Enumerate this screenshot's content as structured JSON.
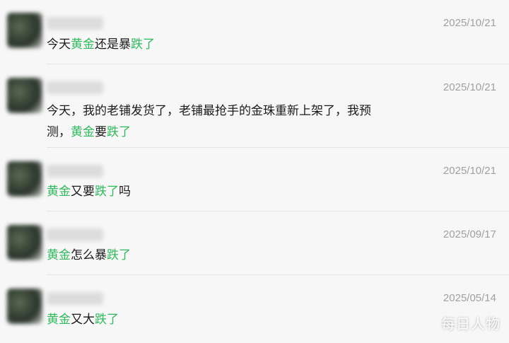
{
  "comments": [
    {
      "date": "2025/10/21",
      "segments": [
        {
          "text": "今天",
          "highlight": false
        },
        {
          "text": "黄金",
          "highlight": true
        },
        {
          "text": "还是暴",
          "highlight": false
        },
        {
          "text": "跌了",
          "highlight": true
        }
      ]
    },
    {
      "date": "2025/10/21",
      "segments": [
        {
          "text": "今天，我的老铺发货了，老铺最抢手的金珠重新上架了，我预",
          "highlight": false
        },
        {
          "text": "\n",
          "highlight": false
        },
        {
          "text": "测，",
          "highlight": false
        },
        {
          "text": "黄金",
          "highlight": true
        },
        {
          "text": "要",
          "highlight": false
        },
        {
          "text": "跌了",
          "highlight": true
        }
      ]
    },
    {
      "date": "2025/10/21",
      "segments": [
        {
          "text": "黄金",
          "highlight": true
        },
        {
          "text": "又要",
          "highlight": false
        },
        {
          "text": "跌了",
          "highlight": true
        },
        {
          "text": "吗",
          "highlight": false
        }
      ]
    },
    {
      "date": "2025/09/17",
      "segments": [
        {
          "text": "黄金",
          "highlight": true
        },
        {
          "text": "怎么暴",
          "highlight": false
        },
        {
          "text": "跌了",
          "highlight": true
        }
      ]
    },
    {
      "date": "2025/05/14",
      "segments": [
        {
          "text": "黄金",
          "highlight": true
        },
        {
          "text": "又大",
          "highlight": false
        },
        {
          "text": "跌了",
          "highlight": true
        }
      ]
    }
  ],
  "watermark": "每日人物",
  "colors": {
    "highlight": "#2fb85c",
    "text": "#1a1a1a",
    "date": "#a0a0a0",
    "background": "#f7f7f7"
  }
}
